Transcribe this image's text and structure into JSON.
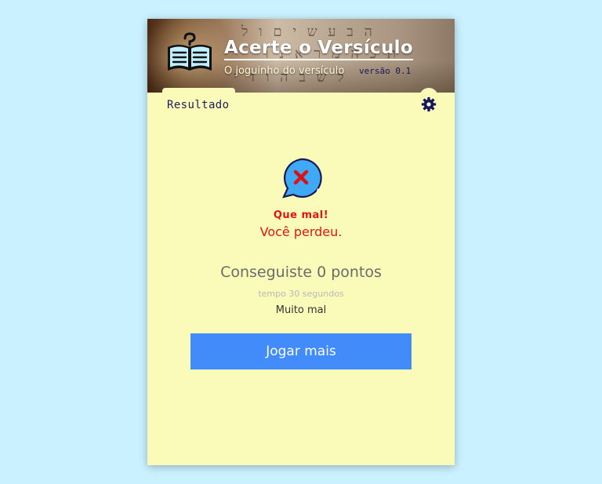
{
  "header": {
    "title": "Acerte o Versículo",
    "subtitle": "O joguinho do versículo",
    "version": "versão 0.1",
    "logo_icon": "book-question-icon"
  },
  "tab": {
    "label": "Resultado"
  },
  "settings": {
    "icon": "gear-icon"
  },
  "result": {
    "icon": "x-speech-bubble-icon",
    "headline": "Que mal!",
    "message": "Você perdeu.",
    "points_text": "Conseguiste 0 pontos",
    "time_text": "tempo 30 segundos",
    "rating": "Muito mal"
  },
  "actions": {
    "play_again_label": "Jogar mais"
  },
  "colors": {
    "page_bg": "#c9f1ff",
    "card_bg": "#fafbb8",
    "loss_red": "#e11414",
    "button_blue": "#418bfb",
    "icon_blue": "#3fa9f5"
  }
}
